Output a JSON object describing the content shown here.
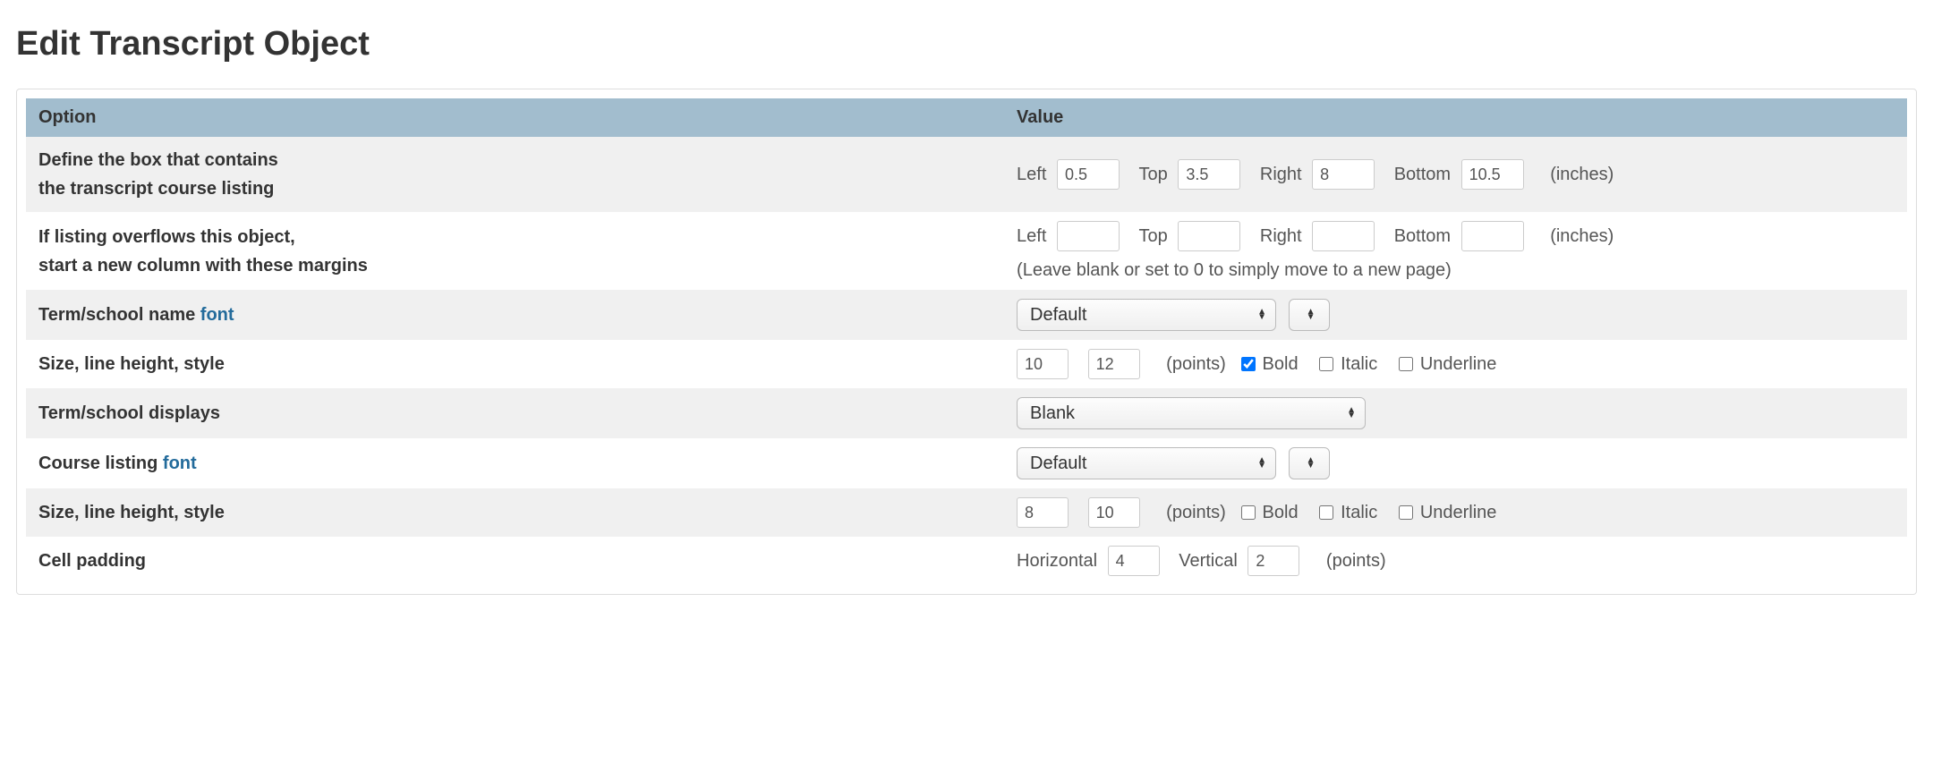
{
  "page_title": "Edit Transcript Object",
  "headers": {
    "option": "Option",
    "value": "Value"
  },
  "units": {
    "inches": "(inches)",
    "points": "(points)"
  },
  "font_link": "font",
  "box": {
    "label_l1": "Define the box that contains",
    "label_l2": "the transcript course listing",
    "left_label": "Left",
    "left": "0.5",
    "top_label": "Top",
    "top": "3.5",
    "right_label": "Right",
    "right": "8",
    "bottom_label": "Bottom",
    "bottom": "10.5"
  },
  "overflow": {
    "label_l1": "If listing overflows this object,",
    "label_l2": "start a new column with these margins",
    "left_label": "Left",
    "left": "",
    "top_label": "Top",
    "top": "",
    "right_label": "Right",
    "right": "",
    "bottom_label": "Bottom",
    "bottom": "",
    "hint": "(Leave blank or set to 0 to simply move to a new page)"
  },
  "term_font": {
    "label_prefix": "Term/school name ",
    "value": "Default"
  },
  "term_style": {
    "label": "Size, line height, style",
    "size": "10",
    "line_height": "12",
    "bold_label": "Bold",
    "bold": true,
    "italic_label": "Italic",
    "italic": false,
    "underline_label": "Underline",
    "underline": false
  },
  "term_displays": {
    "label": "Term/school displays",
    "value": "Blank"
  },
  "course_font": {
    "label_prefix": "Course listing ",
    "value": "Default"
  },
  "course_style": {
    "label": "Size, line height, style",
    "size": "8",
    "line_height": "10",
    "bold_label": "Bold",
    "bold": false,
    "italic_label": "Italic",
    "italic": false,
    "underline_label": "Underline",
    "underline": false
  },
  "cell_padding": {
    "label": "Cell padding",
    "h_label": "Horizontal",
    "h": "4",
    "v_label": "Vertical",
    "v": "2"
  }
}
